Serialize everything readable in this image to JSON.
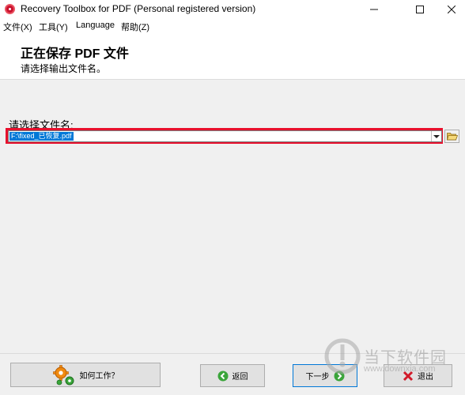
{
  "window": {
    "title": "Recovery Toolbox for PDF (Personal registered version)",
    "minimize_icon": "minimize-icon",
    "maximize_icon": "maximize-icon",
    "close_icon": "close-icon"
  },
  "menu": {
    "items": [
      "文件(X)",
      "工具(Y)",
      "Language",
      "帮助(Z)"
    ]
  },
  "header": {
    "title": "正在保存 PDF 文件",
    "subtitle": "请选择输出文件名。"
  },
  "form": {
    "label": "请选择文件名:",
    "filename_value": "F:\\fixed_已恢复.pdf"
  },
  "buttons": {
    "how_it_works": "如何工作？",
    "back": "返回",
    "next": "下一步",
    "exit": "退出"
  },
  "watermark": {
    "brand": "当下软件园",
    "site": "www.downxia.com"
  },
  "colors": {
    "highlight": "#e8102d",
    "selection": "#0078d7",
    "back_icon": "#3aa53a",
    "next_icon": "#3aa53a",
    "exit_icon": "#d11a2a"
  }
}
